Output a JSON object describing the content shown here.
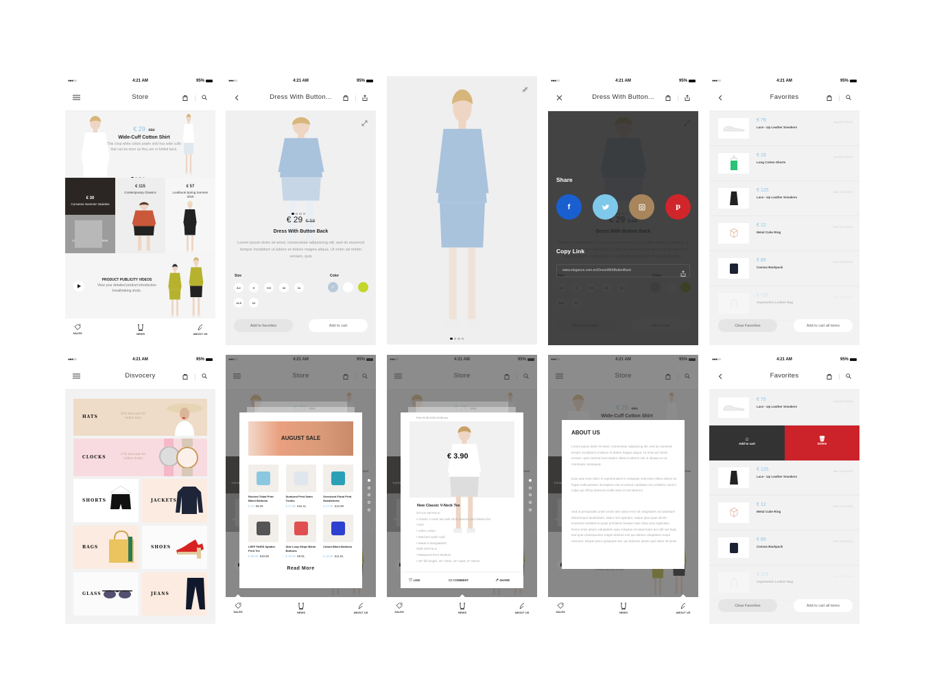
{
  "status": {
    "signal": "●●●○○",
    "time": "4:21 AM",
    "battery": "95%"
  },
  "tabbar": [
    {
      "label": "SALES",
      "icon": "tag-icon"
    },
    {
      "label": "NEWS",
      "icon": "u-news-icon"
    },
    {
      "label": "ABOUT US",
      "icon": "pen-icon"
    }
  ],
  "colors": {
    "accent_blue": "#8cc4e8",
    "delete_red": "#cc2229",
    "dark": "#333333",
    "facebook": "#1a5fd0",
    "twitter": "#7ec8ea",
    "instagram": "#a8855c",
    "pinterest": "#d0262b"
  },
  "store": {
    "title": "Store",
    "hero": {
      "price": "€ 29",
      "old_price": "€59",
      "title": "Wide-Cuff Cotton Shirt",
      "description": "This crisp white cotton poplin shirt has wide cuffs that can be worn as they are or folded back.",
      "page": 1,
      "pages": 4
    },
    "tiles": [
      {
        "price": "€ 30",
        "label": "Converse Summer Varieties"
      },
      {
        "price": "€ 79",
        "label": "Lookbook Spring Summer 2015"
      },
      {
        "price": "€ 115",
        "label": "Contemporary Classics"
      },
      {
        "price": "€ 57",
        "label": "Lookbook Spring Summer 2015"
      }
    ],
    "video": {
      "title": "PRODUCT PUBLICITY VIDEOS",
      "description": "View your detailed product introduction breathtaking shots."
    }
  },
  "product": {
    "title": "Dress With Button...",
    "price": "€ 29",
    "old_price": "€ 59",
    "name": "Dress With Button Back",
    "description": "Lorem ipsum dolor sit amet, consectetur adipisicing elit, sed do eiusmod tempor incididunt ut labore et dolore magna aliqua. Ut enim ad minim veniam, quis",
    "size_label": "Size",
    "sizes": [
      "8.2",
      "9",
      "9.5",
      "10",
      "11",
      "11.5",
      "12"
    ],
    "color_label": "Color",
    "colors": [
      "#b9c9da",
      "#ffffff",
      "#c3d62e"
    ],
    "selected_color": 0,
    "add_favorites": "Add to favorites",
    "add_cart": "Add to cart",
    "page": 1,
    "pages": 4
  },
  "share": {
    "description": "Made from fluid fabric that has been woven to look like denim chambray. It has a shaped back with buttons that run along the length of it. Designed to fall loosely on the body. It is a straight shape with dropped shoulder seams, a wide round neckline and short kimono sleeves.",
    "share_label": "Share",
    "networks": [
      "facebook",
      "twitter",
      "instagram",
      "pinterest"
    ],
    "copy_link_label": "Copy Link",
    "url": "www.elegance.com.en/DressWithButtonBack"
  },
  "favorites": {
    "title": "Favorites",
    "items": [
      {
        "price": "€ 79",
        "name": "Lace - Up Leather Sneakers",
        "date": "Aug 08.13.2015"
      },
      {
        "price": "€ 19",
        "name": "Long Cotton Shorts",
        "date": "Jun 05.10.2015"
      },
      {
        "price": "€ 125",
        "name": "Lace - Up Leather Sneakers",
        "date": "Mar 13.05.2015"
      },
      {
        "price": "€ 12",
        "name": "Metal Cube Ring",
        "date": "Feb 10.07.2015"
      },
      {
        "price": "€ 89",
        "name": "Canvas Backpack",
        "date": "Feb 10.04.2015"
      },
      {
        "price": "€ 125",
        "name": "Asymmetric Leather Bag",
        "date": "Jan 10.07.2015"
      }
    ],
    "clear": "Clear Favorites",
    "add_all": "Add to cart all items",
    "swipe_add": "Add to cart",
    "swipe_delete": "Delete"
  },
  "discovery": {
    "title": "Disvocery",
    "categories": [
      {
        "name": "HATS",
        "note": "20% discount for ladies hats"
      },
      {
        "name": "CLOCKS",
        "note": "15% discount for ladies clocks"
      },
      {
        "name": "SHORTS"
      },
      {
        "name": "JACKETS"
      },
      {
        "name": "BAGS"
      },
      {
        "name": "SHOES"
      },
      {
        "name": "GLASS"
      },
      {
        "name": "JEANS"
      }
    ]
  },
  "sale": {
    "banner": "AUGUST SALE",
    "products": [
      {
        "name": "Ruched Tribal Print Bikini Bottoms",
        "price": "€ 10",
        "old": "€9.20"
      },
      {
        "name": "Sunburst Print Swim Trunks",
        "price": "€ 17.90",
        "old": "€16.11"
      },
      {
        "name": "Oversized Floral Print Sweatshorts",
        "price": "€ 17.00",
        "old": "€12.99"
      },
      {
        "name": "LEEF PARIS Splatter Print Tee",
        "price": "€ 58.00",
        "old": "€49.99"
      },
      {
        "name": "Side Loop Stripe Bikini Bottoms",
        "price": "€ 10.00",
        "old": "€9.81"
      },
      {
        "name": "Cutout Bikini Bottoms",
        "price": "€ 12.00",
        "old": "€11.61"
      }
    ],
    "read_more": "Read More"
  },
  "news": {
    "date": "Feb 24.05.2015 16:00 am",
    "price": "€ 3.90",
    "title": "New Classic V-Neck Tee",
    "lines": [
      "STYLE DETAILS:",
      "A classic V-neck tee with short sleeves and ribbed trim.",
      "•      Knit",
      "•      100% cotton",
      "•      Machine wash cold",
      "•      Made in Bangladesh",
      "SIZE DETAILS:",
      "•      Measured from Medium",
      "•      28\" full length, 42\" chest, 42\" waist, 9\" sleeve"
    ],
    "like": "LIKE",
    "comment": "COMMENT",
    "share": "SHARE"
  },
  "about": {
    "title": "ABOUT US",
    "paragraphs": [
      "Lorem ipsum dolor sit amet, consectetur adipisicing elit, sed do eiusmod tempor incididunt ut labore et dolore magna aliqua. Ut enim ad minim veniam, quis nostrud exercitation ullamco laboris nisi ut aliquip ex ea commodo consequat.",
      "Duis aute irure dolor in reprehenderit in voluptate velit esse cillum dolore eu fugiat nulla pariatur. Excepteur sint occaecat cupidatat non proident, sunt in culpa qui officia deserunt mollit anim id est laborum.",
      "Sed ut perspiciatis unde omnis iste natus error sit voluptatem accusantium doloremque laudantium, totam rem aperiam, eaque ipsa quae ab illo inventore veritatis et quasi architecto beatae vitae dicta sunt explicabo. Nemo enim ipsam voluptatem quia voluptas sit aspernatur aut odit aut fugit, sed quia consequuntur magni dolores eos qui ratione voluptatem sequi nesciunt. Neque porro quisquam est, qui dolorem ipsum quia dolor sit amet,"
    ]
  }
}
